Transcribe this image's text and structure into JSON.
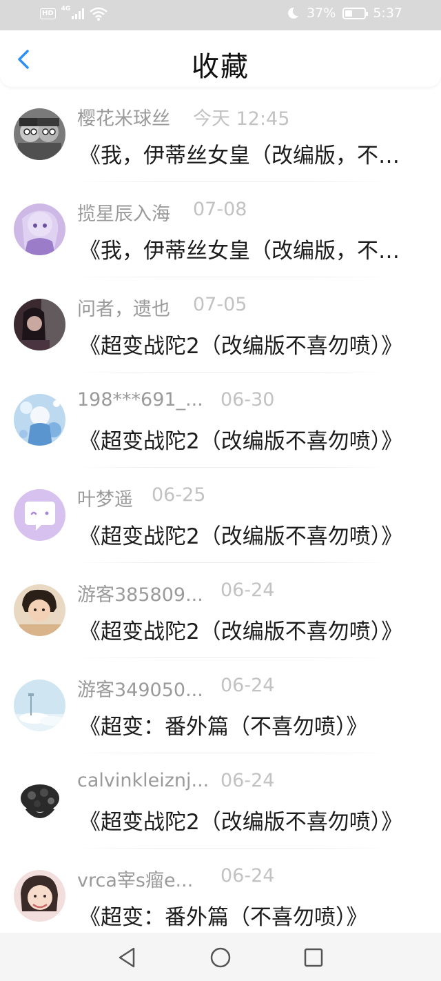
{
  "status_bar": {
    "hd": "HD",
    "network": "4G",
    "battery_percent": "37%",
    "battery_level": 0.37,
    "time": "5:37"
  },
  "header": {
    "title": "收藏",
    "back_icon": "chevron-left-icon",
    "accent_color": "#2a8ff7"
  },
  "favorites": [
    {
      "user": "樱花米球丝",
      "date": "今天 12:45",
      "book": "《我，伊蒂丝女皇（改编版，不喜勿喷）》"
    },
    {
      "user": "揽星辰入海",
      "date": "07-08",
      "book": "《我，伊蒂丝女皇（改编版，不喜勿喷）》"
    },
    {
      "user": "问者，遗也",
      "date": "07-05",
      "book": "《超变战陀2（改编版不喜勿喷）》"
    },
    {
      "user": "198***691_...",
      "date": "06-30",
      "book": "《超变战陀2（改编版不喜勿喷）》"
    },
    {
      "user": "叶梦遥",
      "date": "06-25",
      "book": "《超变战陀2（改编版不喜勿喷）》"
    },
    {
      "user": "游客385809...",
      "date": "06-24",
      "book": "《超变战陀2（改编版不喜勿喷）》"
    },
    {
      "user": "游客349050...",
      "date": "06-24",
      "book": "《超变：番外篇（不喜勿喷）》"
    },
    {
      "user": "calvinkleiznj...",
      "date": "06-24",
      "book": "《超变战陀2（改编版不喜勿喷）》"
    },
    {
      "user": "vrca宰s瘤e...",
      "date": "06-24",
      "book": "《超变：番外篇（不喜勿喷）》"
    }
  ],
  "nav_bar": {
    "back": "triangle-back-icon",
    "home": "circle-home-icon",
    "recents": "square-recents-icon"
  }
}
